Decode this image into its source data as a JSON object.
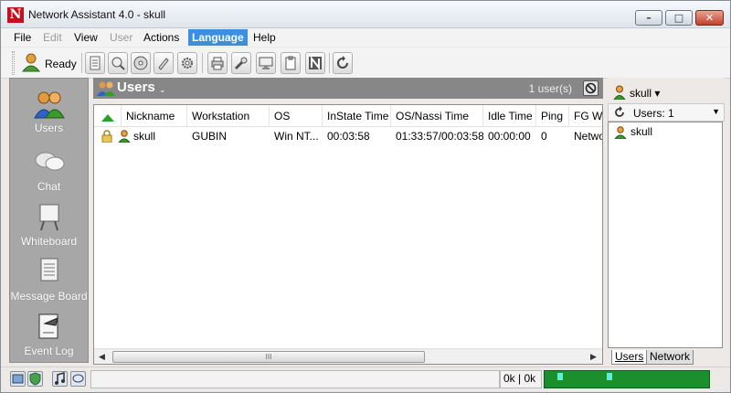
{
  "window": {
    "title": "Network Assistant 4.0 - skull",
    "logo_letter": "N",
    "controls": {
      "minimize": "–",
      "maximize": "□",
      "close": "✕"
    }
  },
  "menu": {
    "items": [
      {
        "label": "File",
        "state": "enabled"
      },
      {
        "label": "Edit",
        "state": "disabled"
      },
      {
        "label": "View",
        "state": "enabled"
      },
      {
        "label": "User",
        "state": "disabled"
      },
      {
        "label": "Actions",
        "state": "enabled"
      },
      {
        "label": "Language",
        "state": "active"
      },
      {
        "label": "Help",
        "state": "enabled"
      }
    ]
  },
  "toolbar": {
    "status_label": "Ready",
    "status_icon": "user-status-icon",
    "buttons": [
      "notes-icon",
      "search-user-icon",
      "disk-icon",
      "edit-icon",
      "gear-icon",
      "print-icon",
      "tools-icon",
      "monitor-icon",
      "clipboard-icon",
      "nassi-icon",
      "refresh-icon"
    ]
  },
  "nav": {
    "items": [
      {
        "label": "Users",
        "icon": "users-icon"
      },
      {
        "label": "Chat",
        "icon": "chat-icon"
      },
      {
        "label": "Whiteboard",
        "icon": "whiteboard-icon"
      },
      {
        "label": "Message Board",
        "icon": "message-board-icon"
      },
      {
        "label": "Event Log",
        "icon": "event-log-icon"
      }
    ]
  },
  "users_panel": {
    "title": "Users",
    "caret": "⌄",
    "count_text": "1 user(s)",
    "columns": [
      "Nickname",
      "Workstation",
      "OS",
      "InState Time",
      "OS/Nassi Time",
      "Idle Time",
      "Ping",
      "FG W"
    ],
    "rows": [
      {
        "nickname": "skull",
        "workstation": "GUBIN",
        "os": "Win NT...",
        "instate": "00:03:58",
        "os_nassi": "01:33:57/00:03:58",
        "idle": "00:00:00",
        "ping": "0",
        "fg": "Netwo"
      }
    ],
    "scroll_grip": "III"
  },
  "right_panel": {
    "current_user": "skull",
    "users_label": "Users: 1",
    "list": [
      "skull"
    ],
    "tabs": [
      {
        "label": "Users",
        "active": true
      },
      {
        "label": "Network",
        "active": false
      }
    ]
  },
  "status": {
    "traffic": "0k | 0k",
    "icons": [
      "network-status-icon",
      "shield-icon",
      "music-icon",
      "chat-status-icon"
    ]
  },
  "colors": {
    "accent": "#3c8fe0",
    "nav_bg": "#a7a7a7",
    "header_bg": "#878787",
    "meter_green": "#1c8f2d"
  }
}
